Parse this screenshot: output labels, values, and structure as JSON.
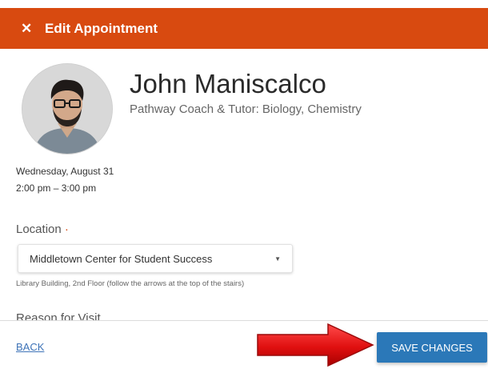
{
  "header": {
    "close_icon": "close-icon",
    "title": "Edit Appointment",
    "color": "#d84a10"
  },
  "coach": {
    "name": "John Maniscalco",
    "role": "Pathway Coach & Tutor: Biology, Chemistry"
  },
  "appointment": {
    "date": "Wednesday, August 31",
    "time": "2:00 pm – 3:00 pm"
  },
  "location": {
    "label": "Location",
    "selected": "Middletown Center for Student Success",
    "hint": "Library Building, 2nd Floor (follow the arrows at the top of the stairs)"
  },
  "reason": {
    "label": "Reason for Visit"
  },
  "footer": {
    "back_label": "BACK",
    "save_label": "SAVE CHANGES",
    "save_color": "#2b78b8"
  },
  "annotation": {
    "arrow_color": "#e02020",
    "arrow_icon": "red-arrow-icon"
  }
}
